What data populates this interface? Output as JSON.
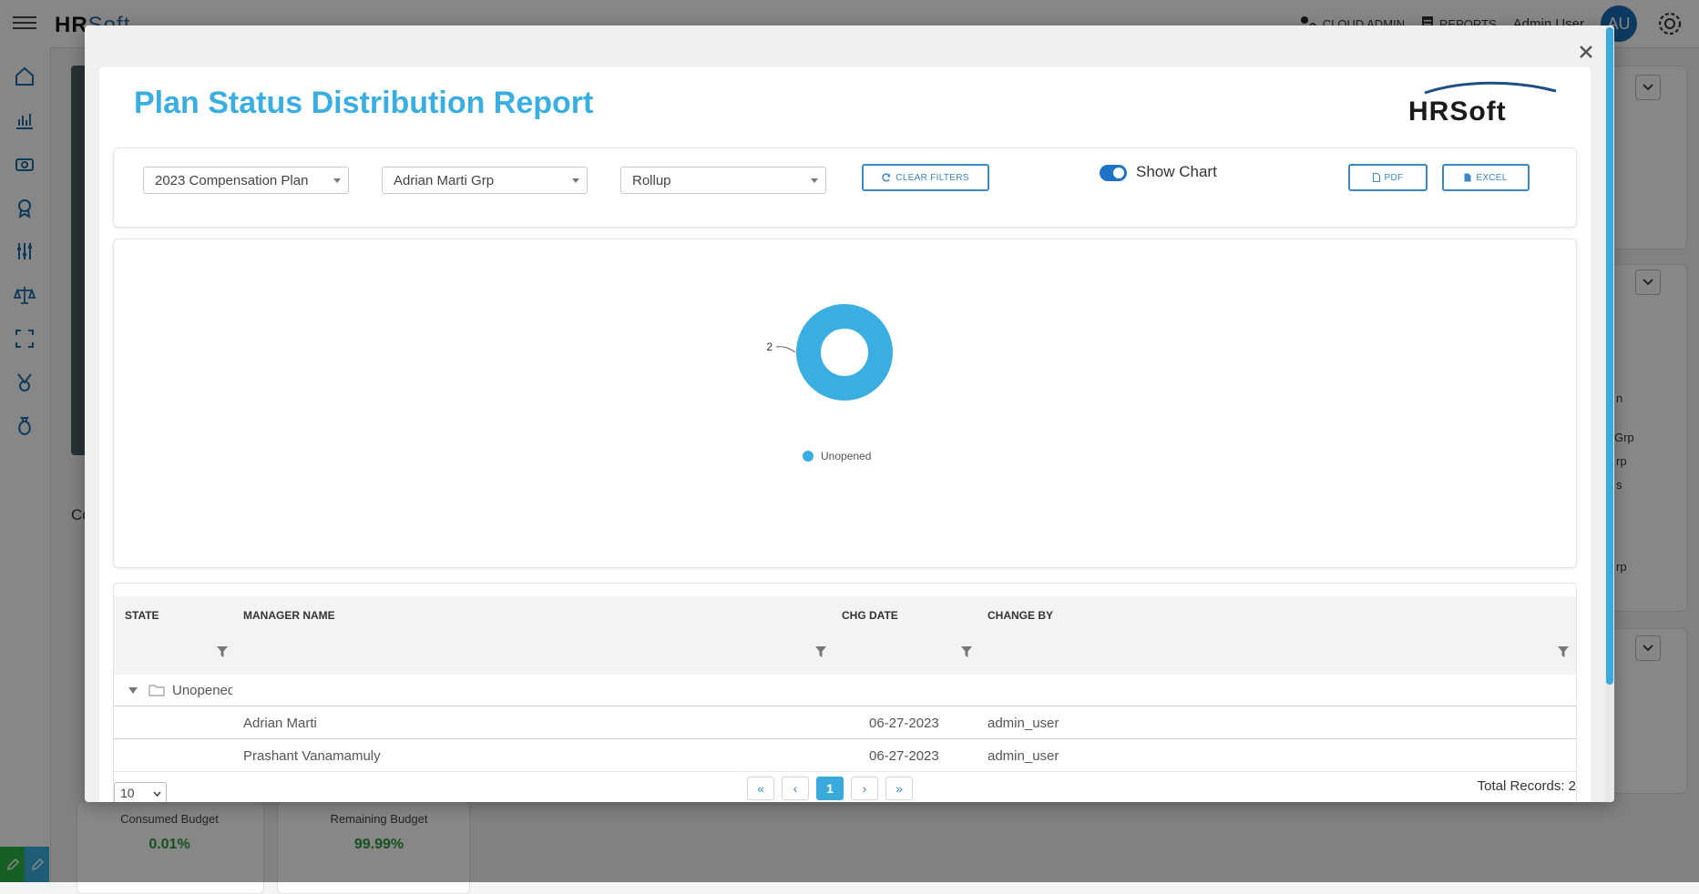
{
  "app": {
    "brand_left": "HR",
    "brand_right": "Soft",
    "top_links": {
      "cloud_admin": "CLOUD ADMIN",
      "reports": "REPORTS"
    },
    "user_name": "Admin User",
    "avatar_initials": "AU",
    "accent_color": "#3aaee0"
  },
  "background": {
    "section_label": "Co",
    "right_fragments": [
      "n",
      "Grp",
      "rp",
      "s",
      "rp"
    ],
    "metrics": [
      {
        "label": "Consumed Budget",
        "value": "0.01%"
      },
      {
        "label": "Remaining Budget",
        "value": "99.99%"
      }
    ]
  },
  "modal": {
    "title": "Plan Status Distribution Report",
    "logo_text": "HRSoft",
    "filters": {
      "plan": "2023 Compensation Plan",
      "group": "Adrian Marti Grp",
      "view": "Rollup",
      "clear_label": "CLEAR FILTERS",
      "show_chart_label": "Show Chart",
      "show_chart_on": true,
      "pdf_label": "PDF",
      "excel_label": "EXCEL"
    },
    "chart_data": {
      "type": "pie",
      "style": "donut",
      "categories": [
        "Unopened"
      ],
      "values": [
        2
      ],
      "data_labels": [
        "2"
      ],
      "colors": [
        "#3aaee0"
      ],
      "legend": "bottom"
    },
    "grid": {
      "columns": [
        "STATE",
        "MANAGER NAME",
        "CHG DATE",
        "CHANGE BY"
      ],
      "group_label": "Unopened",
      "rows": [
        {
          "manager": "Adrian Marti",
          "chg_date": "06-27-2023",
          "change_by": "admin_user"
        },
        {
          "manager": "Prashant Vanamamuly",
          "chg_date": "06-27-2023",
          "change_by": "admin_user"
        }
      ],
      "page_size": "10",
      "current_page": "1",
      "total_records": "Total Records: 2"
    }
  }
}
